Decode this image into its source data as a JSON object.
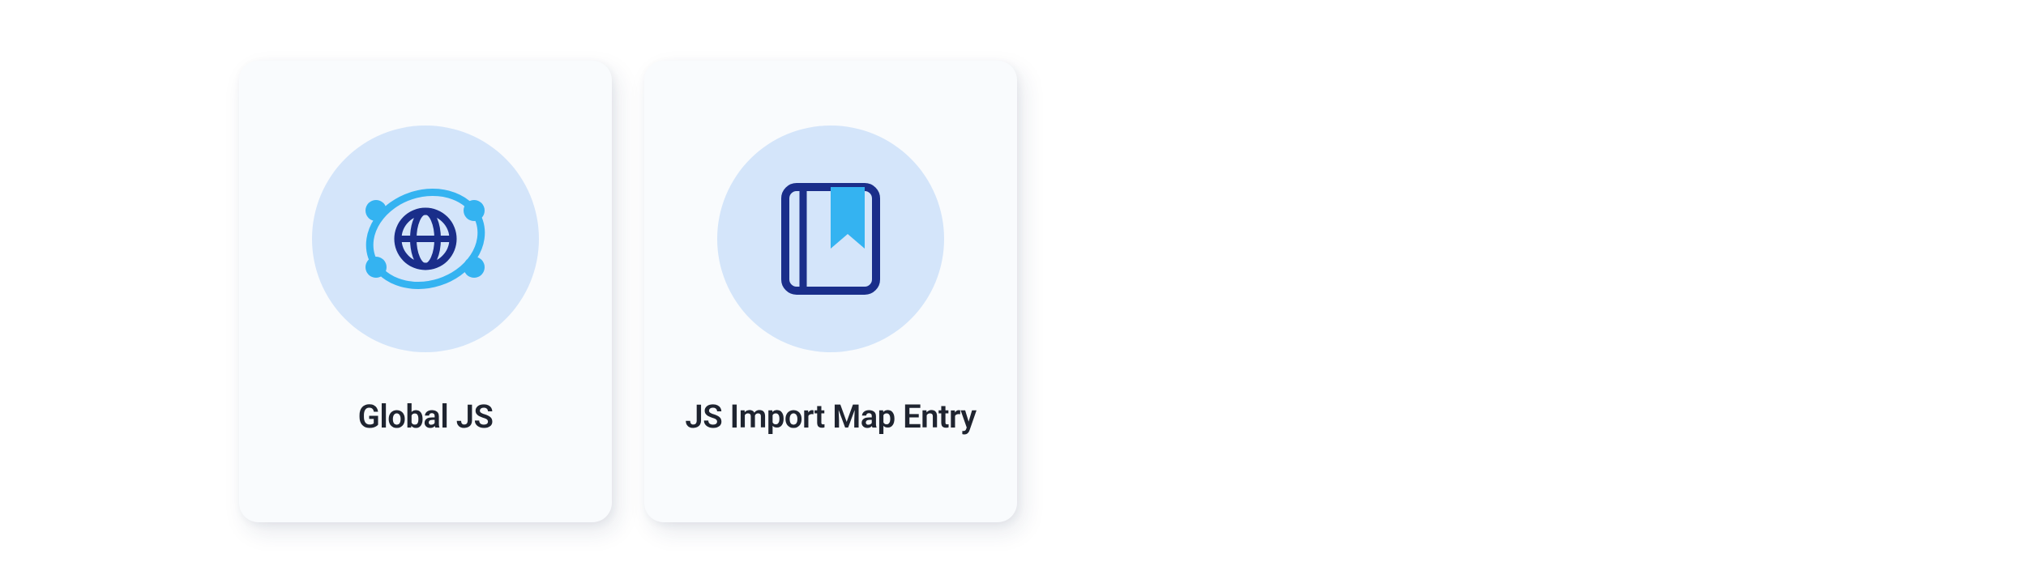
{
  "cards": [
    {
      "icon": "globe-network-icon",
      "label": "Global JS"
    },
    {
      "icon": "book-bookmark-icon",
      "label": "JS Import Map Entry"
    }
  ],
  "colors": {
    "card_bg": "#F9FBFD",
    "circle_bg": "#D4E5FA",
    "accent_primary": "#1F3BB3",
    "accent_secondary": "#34B3F1",
    "text": "#1F2430"
  }
}
